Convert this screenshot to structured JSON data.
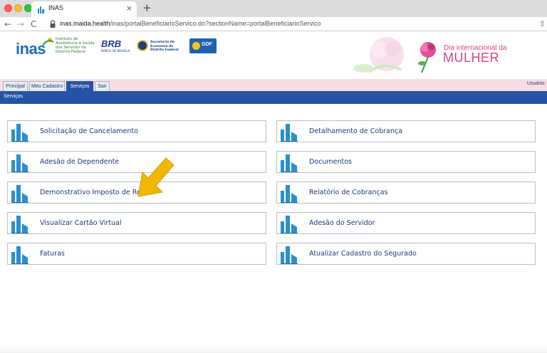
{
  "browser": {
    "tab_title": "INAS",
    "tab_close": "×",
    "new_tab": "+",
    "url_host": "inas.maida.health",
    "url_path": "/inas/portalBeneficiarioServico.do?sectionName=portalBeneficiarioServico",
    "back": "←",
    "forward": "→",
    "reload": "C",
    "share": "⇧"
  },
  "header": {
    "inas_logo_word": "inas",
    "inas_logo_text": "Instituto de Assistência à Saúde dos Servidor do Distrito Federal",
    "brb_logo_word": "BRB",
    "brb_logo_sub": "BANCO DE BRASÍLIA",
    "secretaria_text": "Secretaria de Economia do Distrito Federal",
    "gdf_text": "GDF",
    "banner_subtitle": "Dia internacional da",
    "banner_title": "MULHER"
  },
  "nav": {
    "tabs": [
      {
        "label": "Principal",
        "active": false
      },
      {
        "label": "Meu Cadastro",
        "active": false
      },
      {
        "label": "Serviços",
        "active": true
      },
      {
        "label": "Sair",
        "active": false
      }
    ],
    "user_label": "Usuário:"
  },
  "section": {
    "title": "Serviços"
  },
  "services": {
    "left": [
      "Solicitação de Cancelamento",
      "Adesão de Dependente",
      "Demonstrativo Imposto de Renda",
      "Visualizar Cartão Virtual",
      "Faturas"
    ],
    "right": [
      "Detalhamento de Cobrança",
      "Documentos",
      "Relatório de Cobranças",
      "Adesão do Servidor",
      "Atualizar Cadastro do Segurado"
    ]
  },
  "colors": {
    "primary_blue": "#2553a6",
    "link_text": "#1a3a7a",
    "banner_pink": "#d5428b",
    "icon_blue": "#2a8fd0",
    "arrow_yellow": "#f2b705"
  },
  "icons": {
    "service": "building-bars-icon",
    "annotation": "pointing-arrow-icon"
  }
}
